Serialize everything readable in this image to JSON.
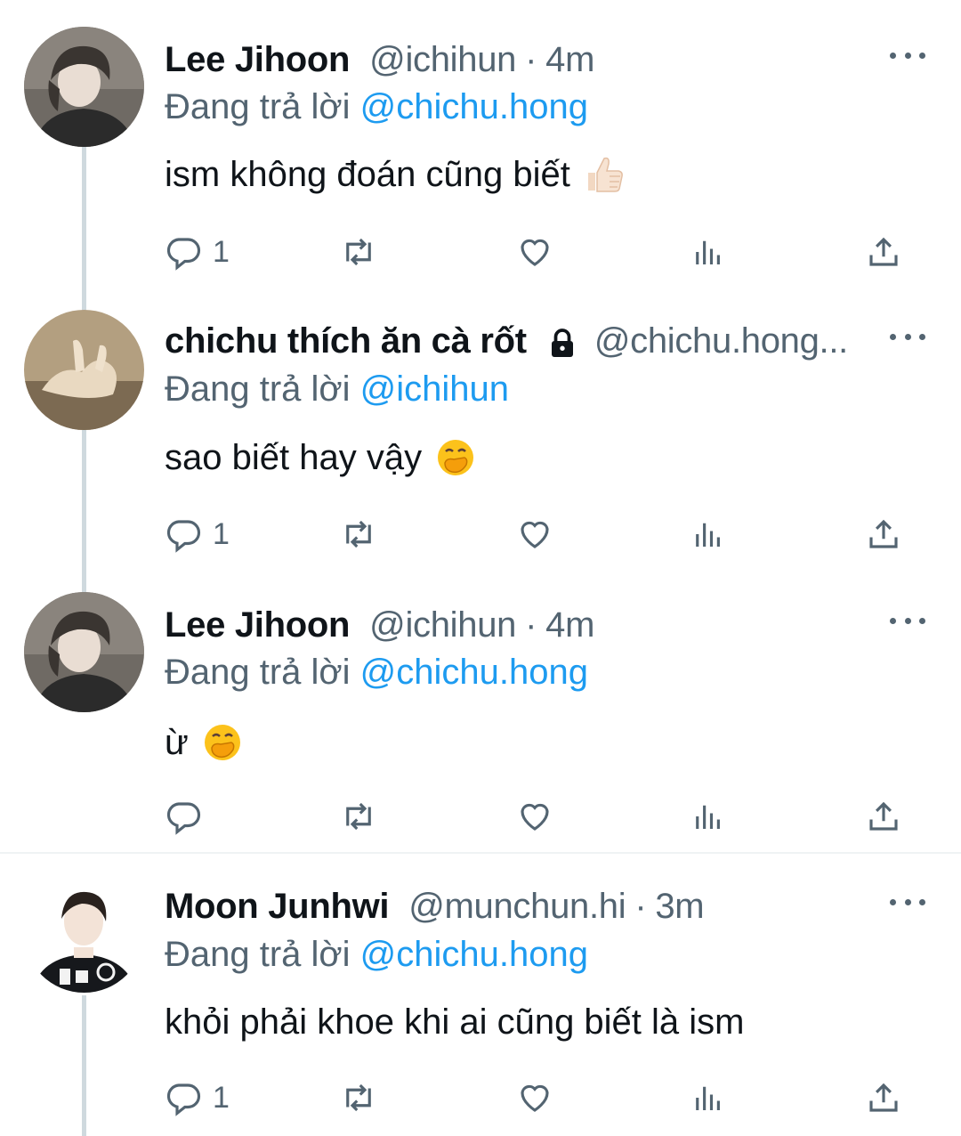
{
  "replying_label": "Đang trả lời",
  "tweets": [
    {
      "name": "Lee Jihoon",
      "handle": "@ichihun",
      "separator": "·",
      "time": "4m",
      "reply_to": "@chichu.hong",
      "text": "ism không đoán cũng biết",
      "emoji": "thumbs-up",
      "reply_count": "1",
      "locked": false
    },
    {
      "name": "chichu thích ăn cà rốt",
      "handle": "@chichu.hong...",
      "separator": "",
      "time": "",
      "reply_to": "@ichihun",
      "text": "sao biết hay vậy",
      "emoji": "hand-over-mouth",
      "reply_count": "1",
      "locked": true
    },
    {
      "name": "Lee Jihoon",
      "handle": "@ichihun",
      "separator": "·",
      "time": "4m",
      "reply_to": "@chichu.hong",
      "text": "ừ",
      "emoji": "hand-over-mouth",
      "reply_count": "",
      "locked": false
    },
    {
      "name": "Moon Junhwi",
      "handle": "@munchun.hi",
      "separator": "·",
      "time": "3m",
      "reply_to": "@chichu.hong",
      "text": "khỏi phải khoe khi ai cũng biết là ism",
      "emoji": "",
      "reply_count": "1",
      "locked": false
    }
  ],
  "icons": {
    "reply": "reply-icon",
    "retweet": "retweet-icon",
    "like": "heart-icon",
    "views": "views-icon",
    "share": "share-icon",
    "more": "more-icon",
    "lock": "lock-icon"
  },
  "colors": {
    "link": "#1d9bf0",
    "secondary": "#536471",
    "text": "#0f1419",
    "thread_line": "#cfd9de"
  }
}
